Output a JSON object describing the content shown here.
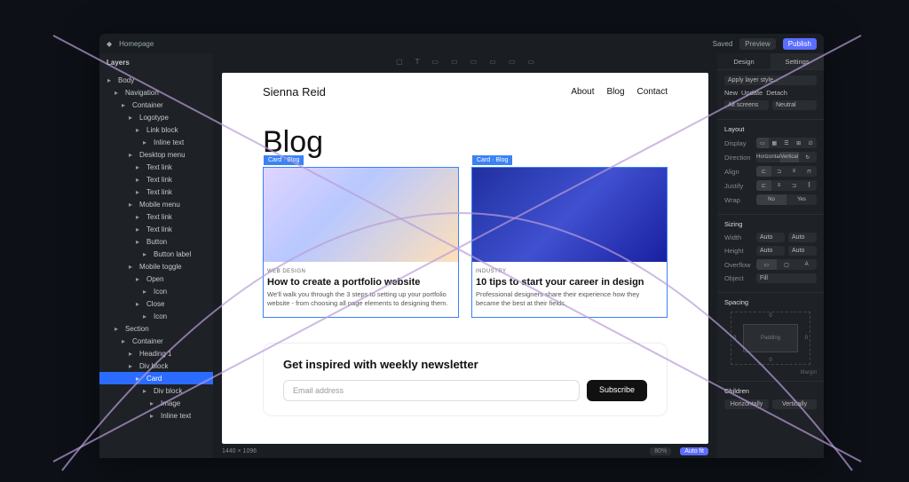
{
  "topbar": {
    "doc": "Homepage",
    "saved": "Saved",
    "preview": "Preview",
    "publish": "Publish"
  },
  "sidebar": {
    "header": "Layers",
    "tree": [
      {
        "lbl": "Body",
        "d": 0
      },
      {
        "lbl": "Navigation",
        "d": 1
      },
      {
        "lbl": "Container",
        "d": 2
      },
      {
        "lbl": "Logotype",
        "d": 3
      },
      {
        "lbl": "Link block",
        "d": 4
      },
      {
        "lbl": "Inline text",
        "d": 5
      },
      {
        "lbl": "Desktop menu",
        "d": 3
      },
      {
        "lbl": "Text link",
        "d": 4
      },
      {
        "lbl": "Text link",
        "d": 4
      },
      {
        "lbl": "Text link",
        "d": 4
      },
      {
        "lbl": "Mobile menu",
        "d": 3
      },
      {
        "lbl": "Text link",
        "d": 4
      },
      {
        "lbl": "Text link",
        "d": 4
      },
      {
        "lbl": "Button",
        "d": 4
      },
      {
        "lbl": "Button label",
        "d": 5
      },
      {
        "lbl": "Mobile toggle",
        "d": 3
      },
      {
        "lbl": "Open",
        "d": 4
      },
      {
        "lbl": "Icon",
        "d": 5
      },
      {
        "lbl": "Close",
        "d": 4
      },
      {
        "lbl": "Icon",
        "d": 5
      },
      {
        "lbl": "Section",
        "d": 1
      },
      {
        "lbl": "Container",
        "d": 2
      },
      {
        "lbl": "Heading 1",
        "d": 3
      },
      {
        "lbl": "Div block",
        "d": 3
      },
      {
        "lbl": "Card",
        "d": 4,
        "sel": true
      },
      {
        "lbl": "Div block",
        "d": 5
      },
      {
        "lbl": "Image",
        "d": 6
      },
      {
        "lbl": "Inline text",
        "d": 6
      }
    ]
  },
  "canvas": {
    "brand": "Sienna Reid",
    "nav": [
      "About",
      "Blog",
      "Contact"
    ],
    "heading": "Blog",
    "card_tag": "Card · Blog",
    "cards": [
      {
        "cat": "WEB DESIGN",
        "title": "How to create a portfolio website",
        "desc": "We'll walk you through the 3 steps to setting up your portfolio website - from choosing all page elements to designing them."
      },
      {
        "cat": "INDUSTRY",
        "title": "10 tips to start your career in design",
        "desc": "Professional designers share their experience how they became the best at their fields."
      }
    ],
    "newsletter": {
      "heading": "Get inspired with weekly newsletter",
      "placeholder": "Email address",
      "btn": "Subscribe"
    }
  },
  "status": {
    "size": "1440 × 1096",
    "autofit": "Auto fit"
  },
  "inspector": {
    "tabs": [
      "Design",
      "Settings"
    ],
    "apply_style": "Apply layer style...",
    "new": "New",
    "update": "Update",
    "detach": "Detach",
    "screens": "All screens",
    "state": "Neutral",
    "layout": {
      "title": "Layout",
      "display": "Display",
      "direction": "Direction",
      "dir_opts": [
        "Horizontal",
        "Vertical"
      ],
      "align": "Align",
      "justify": "Justify",
      "wrap": "Wrap",
      "wrap_opts": [
        "No",
        "Yes"
      ]
    },
    "sizing": {
      "title": "Sizing",
      "width": "Width",
      "auto": "Auto",
      "height": "Height",
      "overflow": "Overflow",
      "object": "Object",
      "fill": "Fill"
    },
    "spacing": {
      "title": "Spacing",
      "padding": "Padding",
      "margin": "Margin"
    },
    "children": {
      "title": "Children",
      "h": "Horizontally",
      "v": "Vertically"
    }
  }
}
